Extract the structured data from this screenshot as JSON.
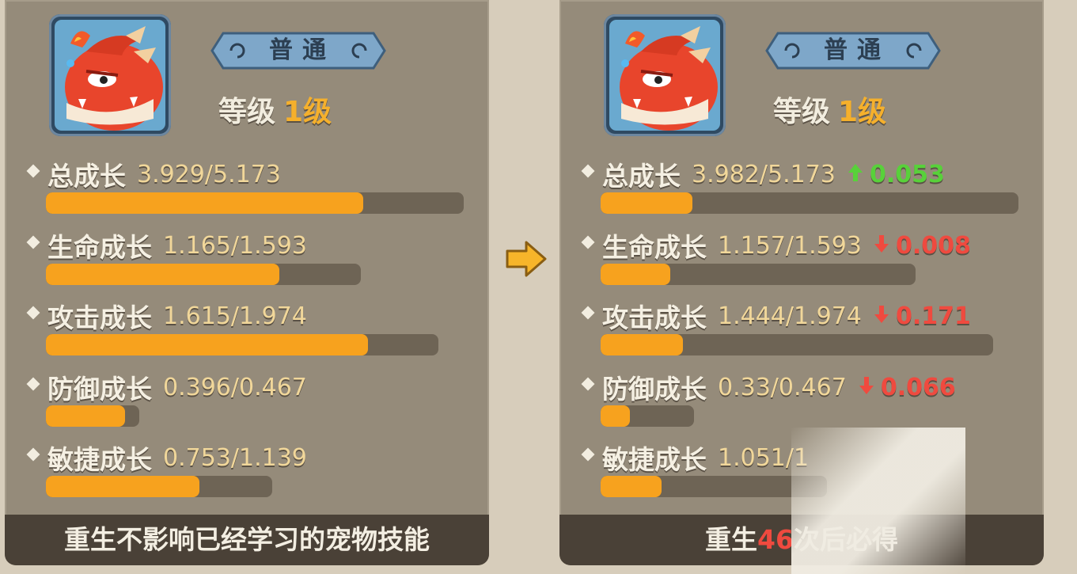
{
  "compare": {
    "left": {
      "rarity": "普通",
      "level_label": "等级",
      "level_value": "1级",
      "stats": [
        {
          "label": "总成长",
          "value": "3.929/5.173",
          "fraction": 0.76
        },
        {
          "label": "生命成长",
          "value": "1.165/1.593",
          "fraction": 0.74
        },
        {
          "label": "攻击成长",
          "value": "1.615/1.974",
          "fraction": 0.82
        },
        {
          "label": "防御成长",
          "value": "0.396/0.467",
          "fraction": 0.85
        },
        {
          "label": "敏捷成长",
          "value": "0.753/1.139",
          "fraction": 0.68
        }
      ],
      "footer": "重生不影响已经学习的宠物技能"
    },
    "right": {
      "rarity": "普通",
      "level_label": "等级",
      "level_value": "1级",
      "stats": [
        {
          "label": "总成长",
          "value": "3.982/5.173",
          "delta": "0.053",
          "direction": "up",
          "fraction": 0.22
        },
        {
          "label": "生命成长",
          "value": "1.157/1.593",
          "delta": "0.008",
          "direction": "down",
          "fraction": 0.22
        },
        {
          "label": "攻击成长",
          "value": "1.444/1.974",
          "delta": "0.171",
          "direction": "down",
          "fraction": 0.21
        },
        {
          "label": "防御成长",
          "value": "0.33/0.467",
          "delta": "0.066",
          "direction": "down",
          "fraction": 0.31
        },
        {
          "label": "敏捷成长",
          "value": "1.051/1",
          "fraction": 0.27
        }
      ],
      "footer_prefix": "重生",
      "footer_count": "46",
      "footer_suffix": "次后必得"
    }
  },
  "colors": {
    "bar_fill": "#f7a21e",
    "delta_up": "#58d13a",
    "delta_down": "#ef4a3f",
    "level_value": "#f5b02c"
  },
  "icons": {
    "pet": "red-dragon-pet-icon",
    "transfer": "right-arrow-icon"
  }
}
